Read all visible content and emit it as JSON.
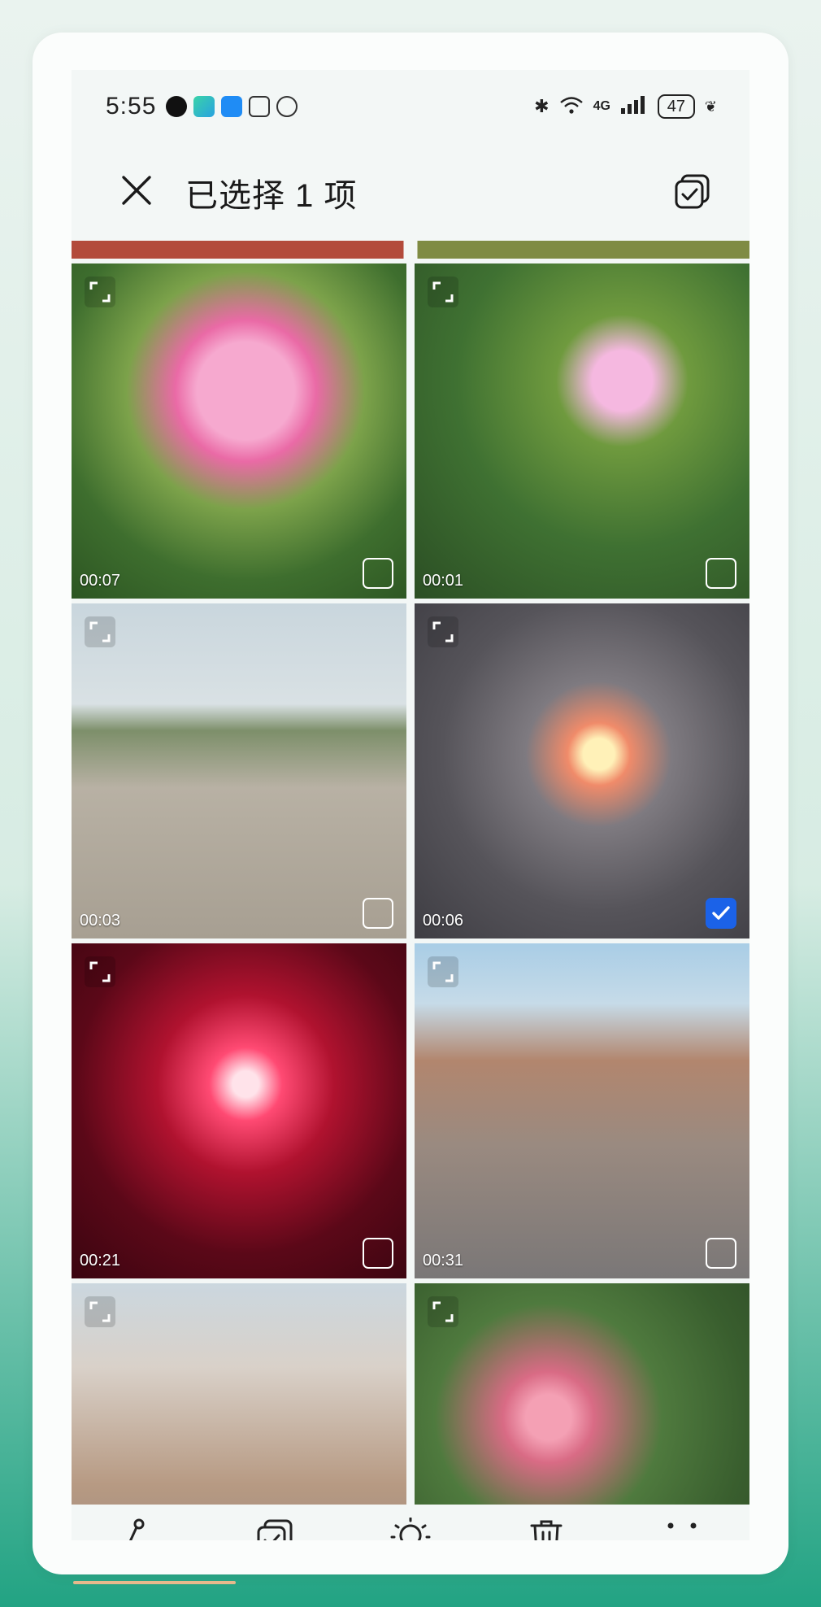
{
  "status_bar": {
    "time": "5:55",
    "network_label": "4G",
    "battery_level": "47"
  },
  "header": {
    "title": "已选择 1 项",
    "close_icon": "close-icon",
    "select_all_icon": "multi-select-icon"
  },
  "grid": {
    "items": [
      {
        "duration": "00:07",
        "selected": false,
        "subject": "peony"
      },
      {
        "duration": "00:01",
        "selected": false,
        "subject": "bindweed"
      },
      {
        "duration": "00:03",
        "selected": false,
        "subject": "village-road"
      },
      {
        "duration": "00:06",
        "selected": true,
        "subject": "night-stage"
      },
      {
        "duration": "00:21",
        "selected": false,
        "subject": "fireworks"
      },
      {
        "duration": "00:31",
        "selected": false,
        "subject": "stilt-parade"
      },
      {
        "duration": "",
        "selected": false,
        "subject": "street"
      },
      {
        "duration": "",
        "selected": false,
        "subject": "roses"
      }
    ]
  },
  "toolbar": {
    "share_label": "分享",
    "select_all_label": "全选",
    "create_label": "创作",
    "delete_label": "删除",
    "more_label": "更多"
  },
  "colors": {
    "accent": "#1b62e8",
    "text": "#1a1a1a",
    "background": "#f3f7f6"
  }
}
